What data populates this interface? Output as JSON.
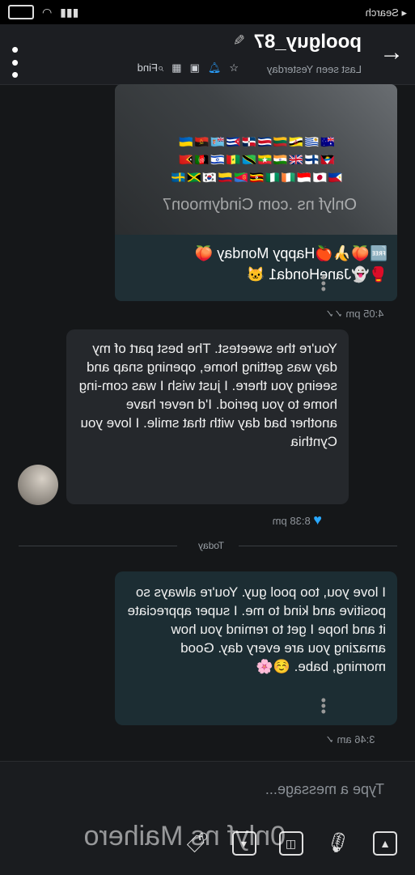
{
  "status": {
    "back_label": "◂ Search"
  },
  "header": {
    "title": "poolguy_87",
    "last_seen": "Last seen Yesterday",
    "find_label": "Find"
  },
  "messages": {
    "image_msg": {
      "watermark": "Onlyf ns .com Cindymoon7",
      "flags_line1": "🇦🇺🇺🇾🇧🇳🇱🇹🇨🇷🇩🇴🇨🇺🇫🇯🇦🇴🇺🇦",
      "flags_line2": "🇦🇬🇫🇮🇬🇧🇮🇳🇲🇲🇹🇿🇸🇳🇮🇱🇦🇫🇹🇱",
      "flags_line3": "🇵🇭🇯🇵🇮🇩🇮🇪🇳🇬🇺🇬🇪🇷🇨🇴🇰🇷🇯🇲🇸🇪",
      "caption_line1": "🆓🍑🍌🍎Happy Monday 🍑",
      "caption_line2": "🥊👻JaneHonda1 🐱",
      "time": "4:05 pm"
    },
    "incoming_msg": {
      "text": "You're the sweetest. The best part of my day was getting home, opening snap and seeing you there. I just wish I was com-ing home to you period. I'd never have another bad day with that smile. I love you Cynthia",
      "time": "8:38 pm"
    },
    "day_separator": "Today",
    "outgoing_msg": {
      "text": "I love you, too pool guy. You're always so positive and kind to me. I super appreciate it and hope I get to remind you how amazing you are every day. Good morning, babe. ☺️🌸",
      "time": "3:46 am"
    }
  },
  "composer": {
    "placeholder": "Type a message...",
    "watermark": "0nlyf ns Maihero"
  }
}
